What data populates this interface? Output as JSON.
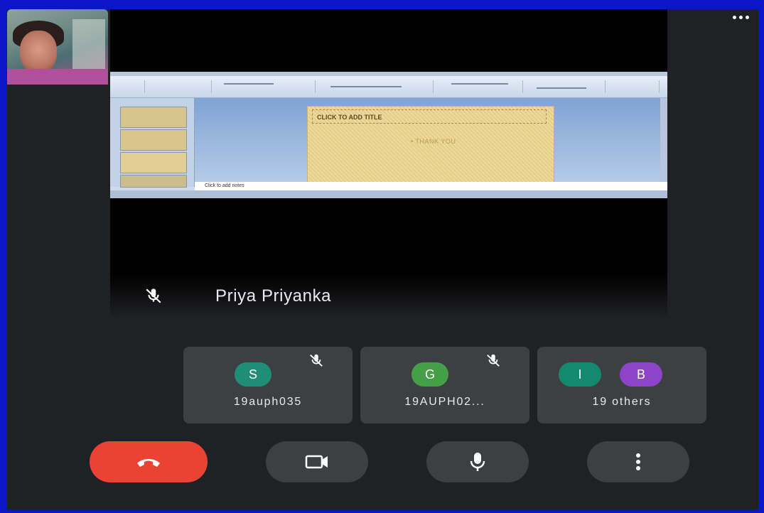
{
  "presenter": {
    "name": "Priya Priyanka",
    "mic_state": "muted",
    "screen_share": {
      "slide_title_placeholder": "CLICK TO ADD TITLE",
      "slide_body_text": "• THANK YOU",
      "notes_placeholder": "Click to add notes"
    }
  },
  "participants": [
    {
      "initial": "S",
      "name": "19auph035",
      "avatar_color": "#1e8e74",
      "mic_state": "muted"
    },
    {
      "initial": "G",
      "name": "19AUPH02...",
      "avatar_color": "#43a047",
      "mic_state": "muted"
    }
  ],
  "others_tile": {
    "initials": [
      "I",
      "B"
    ],
    "avatar_colors": [
      "#138a6e",
      "#8e44c7"
    ],
    "label": "19 others"
  },
  "self_tile": {
    "menu_icon": "more-horiz-icon"
  },
  "controls": {
    "end_call_icon": "call-end-icon",
    "camera_icon": "videocam-icon",
    "mic_icon": "mic-icon",
    "more_icon": "more-vert-icon"
  },
  "colors": {
    "background": "#202124",
    "tile": "#3c4043",
    "end_call": "#ea4335",
    "frame": "#0b16c9"
  }
}
